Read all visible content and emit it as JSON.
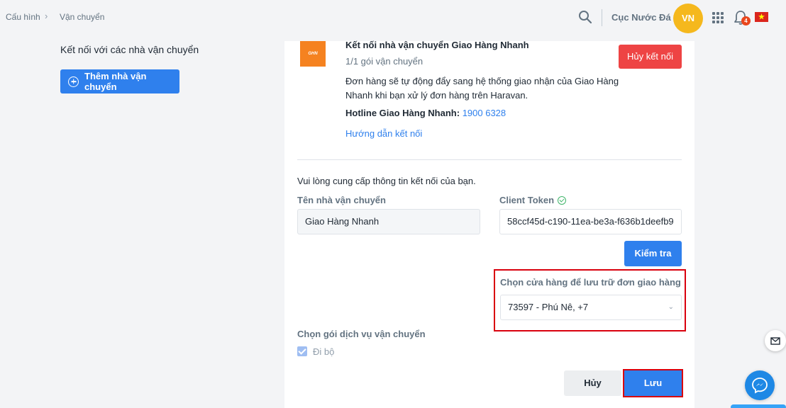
{
  "breadcrumb": {
    "root": "Cấu hình",
    "separator": "›",
    "current": "Vận chuyển"
  },
  "header": {
    "store_name": "Cục Nước Đá",
    "avatar_initials": "VN",
    "notification_count": "4"
  },
  "sidebar": {
    "title": "Kết nối với các nhà vận chuyển",
    "add_button": "Thêm nhà vận chuyển"
  },
  "carrier": {
    "logo_text": "GHN",
    "title": "Kết nối nhà vận chuyển Giao Hàng Nhanh",
    "package_count": "1/1 gói vận chuyển",
    "description": "Đơn hàng sẽ tự động đẩy sang hệ thống giao nhận của Giao Hàng Nhanh khi bạn xử lý đơn hàng trên Haravan.",
    "hotline_label": "Hotline Giao Hàng Nhanh:",
    "hotline_number": "1900 6328",
    "guide_link": "Hướng dẫn kết nối",
    "disconnect_button": "Hủy kết nối"
  },
  "form": {
    "prompt": "Vui lòng cung cấp thông tin kết nối của bạn.",
    "carrier_name_label": "Tên nhà vận chuyển",
    "carrier_name_value": "Giao Hàng Nhanh",
    "token_label": "Client Token",
    "token_value": "58ccf45d-c190-11ea-be3a-f636b1deefb9",
    "check_button": "Kiểm tra",
    "store_label": "Chọn cửa hàng để lưu trữ đơn giao hàng",
    "store_value": "73597 - Phú Nê, +7",
    "service_label": "Chọn gói dịch vụ vận chuyển",
    "service_option": "Đi bộ",
    "cancel_button": "Hủy",
    "save_button": "Lưu"
  },
  "colors": {
    "primary": "#2f80ed",
    "danger": "#ee4444",
    "highlight": "#d9000d",
    "avatar": "#f5b81d"
  }
}
